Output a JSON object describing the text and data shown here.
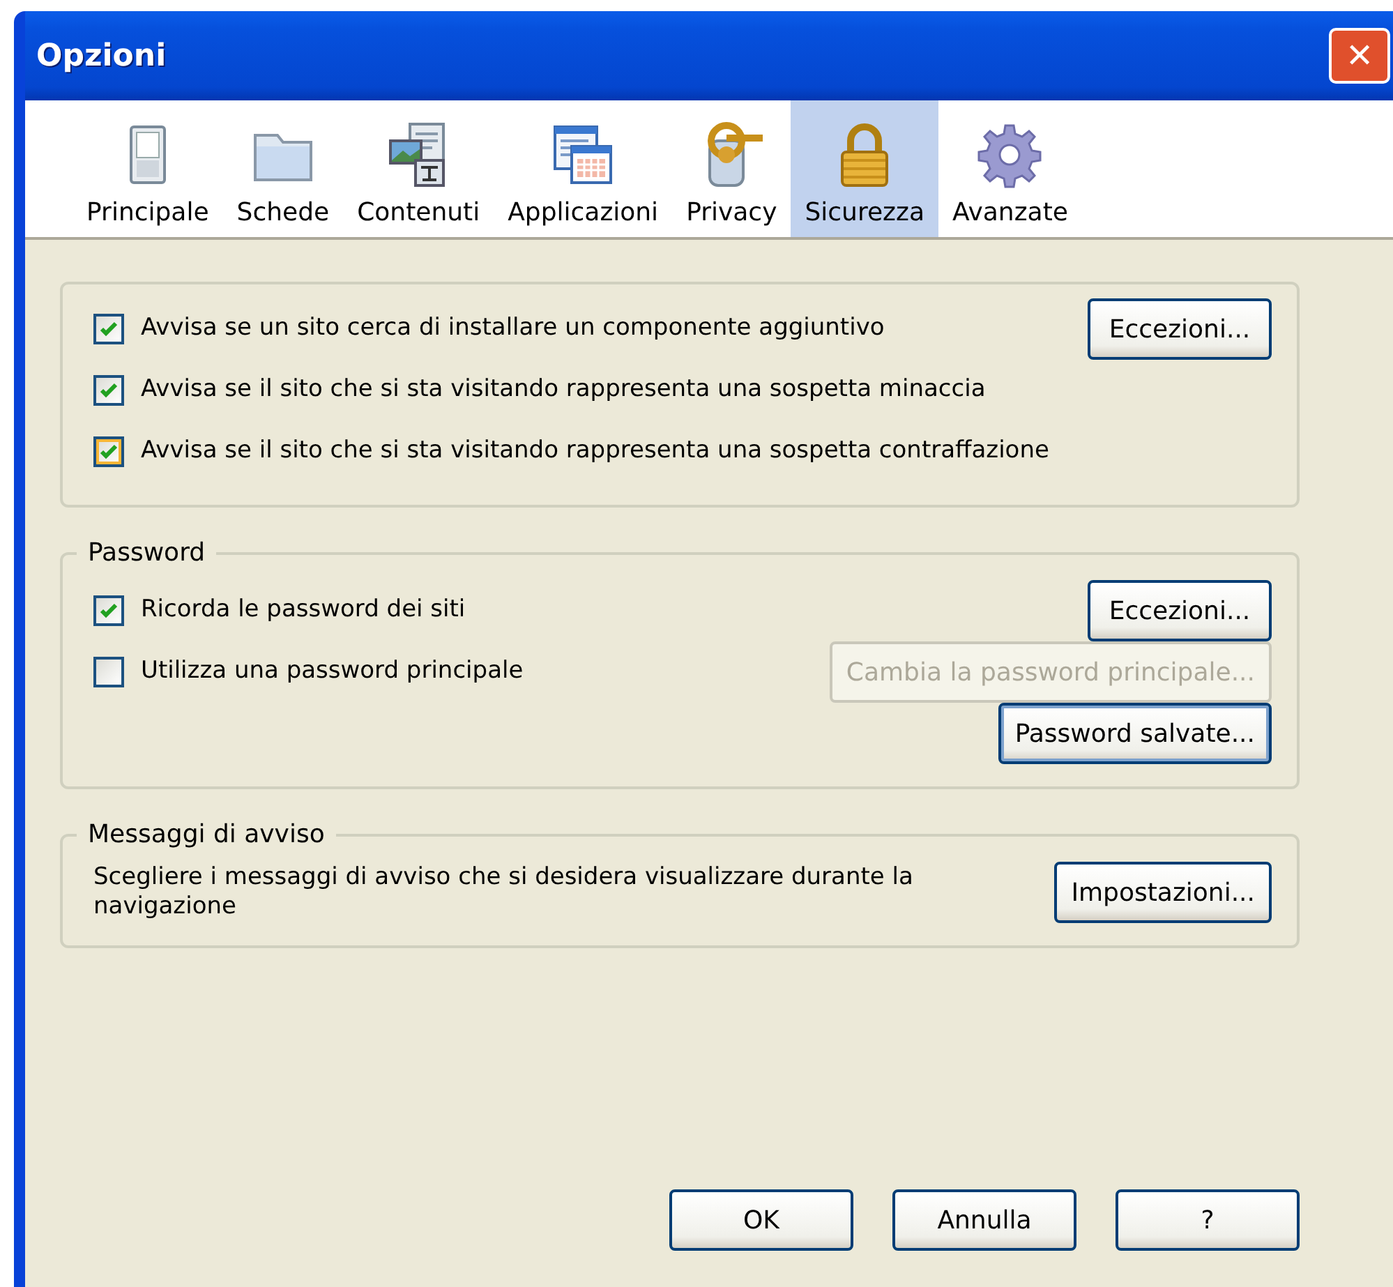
{
  "window": {
    "title": "Opzioni",
    "close": "✕"
  },
  "tabs": [
    {
      "label": "Principale",
      "selected": false
    },
    {
      "label": "Schede",
      "selected": false
    },
    {
      "label": "Contenuti",
      "selected": false
    },
    {
      "label": "Applicazioni",
      "selected": false
    },
    {
      "label": "Privacy",
      "selected": false
    },
    {
      "label": "Sicurezza",
      "selected": true
    },
    {
      "label": "Avanzate",
      "selected": false
    }
  ],
  "groups": [
    {
      "items": [
        {
          "kind": "checkbox",
          "label": "Avvisa se un sito cerca di installare un componente aggiuntivo",
          "checked": true,
          "hovered": false,
          "button": {
            "label": "Eccezioni...",
            "disabled": false,
            "focused": false
          }
        },
        {
          "kind": "checkbox",
          "label": "Avvisa se il sito che si sta visitando rappresenta una sospetta minaccia",
          "checked": true,
          "hovered": false
        },
        {
          "kind": "checkbox",
          "label": "Avvisa se il sito che si sta visitando rappresenta una sospetta contraffazione",
          "checked": true,
          "hovered": true
        }
      ]
    },
    {
      "legend": "Password",
      "items": [
        {
          "kind": "checkbox",
          "label": "Ricorda le password dei siti",
          "checked": true,
          "hovered": false,
          "button": {
            "label": "Eccezioni...",
            "disabled": false,
            "focused": false
          }
        },
        {
          "kind": "checkbox",
          "label": "Utilizza una password principale",
          "checked": false,
          "hovered": false,
          "button": {
            "label": "Cambia la password principale...",
            "disabled": true,
            "focused": false
          }
        },
        {
          "kind": "button",
          "button": {
            "label": "Password salvate...",
            "disabled": false,
            "focused": true
          }
        }
      ]
    },
    {
      "legend": "Messaggi di avviso",
      "items": [
        {
          "kind": "text",
          "label": "Scegliere i messaggi di avviso che si desidera visualizzare durante la navigazione",
          "button": {
            "label": "Impostazioni...",
            "disabled": false,
            "focused": false
          }
        }
      ]
    }
  ],
  "buttons": [
    {
      "label": "OK",
      "disabled": false,
      "focused": false
    },
    {
      "label": "Annulla",
      "disabled": false,
      "focused": false
    },
    {
      "label": "?",
      "disabled": false,
      "focused": false
    }
  ]
}
